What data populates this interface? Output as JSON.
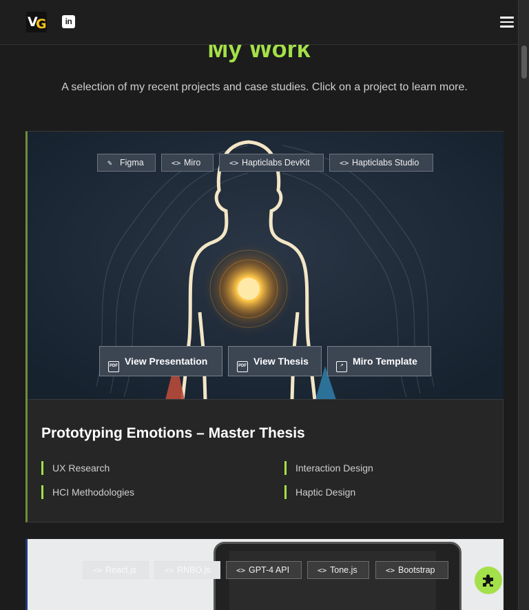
{
  "header": {
    "logo_v": "V",
    "logo_g": "G",
    "linkedin_label": "in",
    "menu_icon": "hamburger-icon"
  },
  "page": {
    "title": "My Work",
    "intro": "A selection of my recent projects and case studies. Click on a project to learn more."
  },
  "projects": [
    {
      "title": "Prototyping Emotions – Master Thesis",
      "tools": [
        {
          "icon": "tools-icon",
          "label": "Figma"
        },
        {
          "icon": "code-icon",
          "label": "Miro"
        },
        {
          "icon": "code-icon",
          "label": "Hapticlabs DevKit"
        },
        {
          "icon": "code-icon",
          "label": "Hapticlabs Studio"
        }
      ],
      "actions": [
        {
          "icon": "pdf-icon",
          "label": "View Presentation"
        },
        {
          "icon": "pdf-icon",
          "label": "View Thesis"
        },
        {
          "icon": "external-link-icon",
          "label": "Miro Template"
        }
      ],
      "skills": [
        "UX Research",
        "Interaction Design",
        "HCI Methodologies",
        "Haptic Design"
      ],
      "accent": "#6f8f3a"
    },
    {
      "tools": [
        {
          "icon": "code-icon",
          "label": "React.js"
        },
        {
          "icon": "code-icon",
          "label": "RNBO.js"
        },
        {
          "icon": "code-icon",
          "label": "GPT-4 API"
        },
        {
          "icon": "code-icon",
          "label": "Tone.js"
        },
        {
          "icon": "code-icon",
          "label": "Bootstrap"
        }
      ],
      "accent": "#1f3a7a"
    }
  ],
  "colors": {
    "brand_green": "#a4e049",
    "background": "#1c1c1c"
  }
}
